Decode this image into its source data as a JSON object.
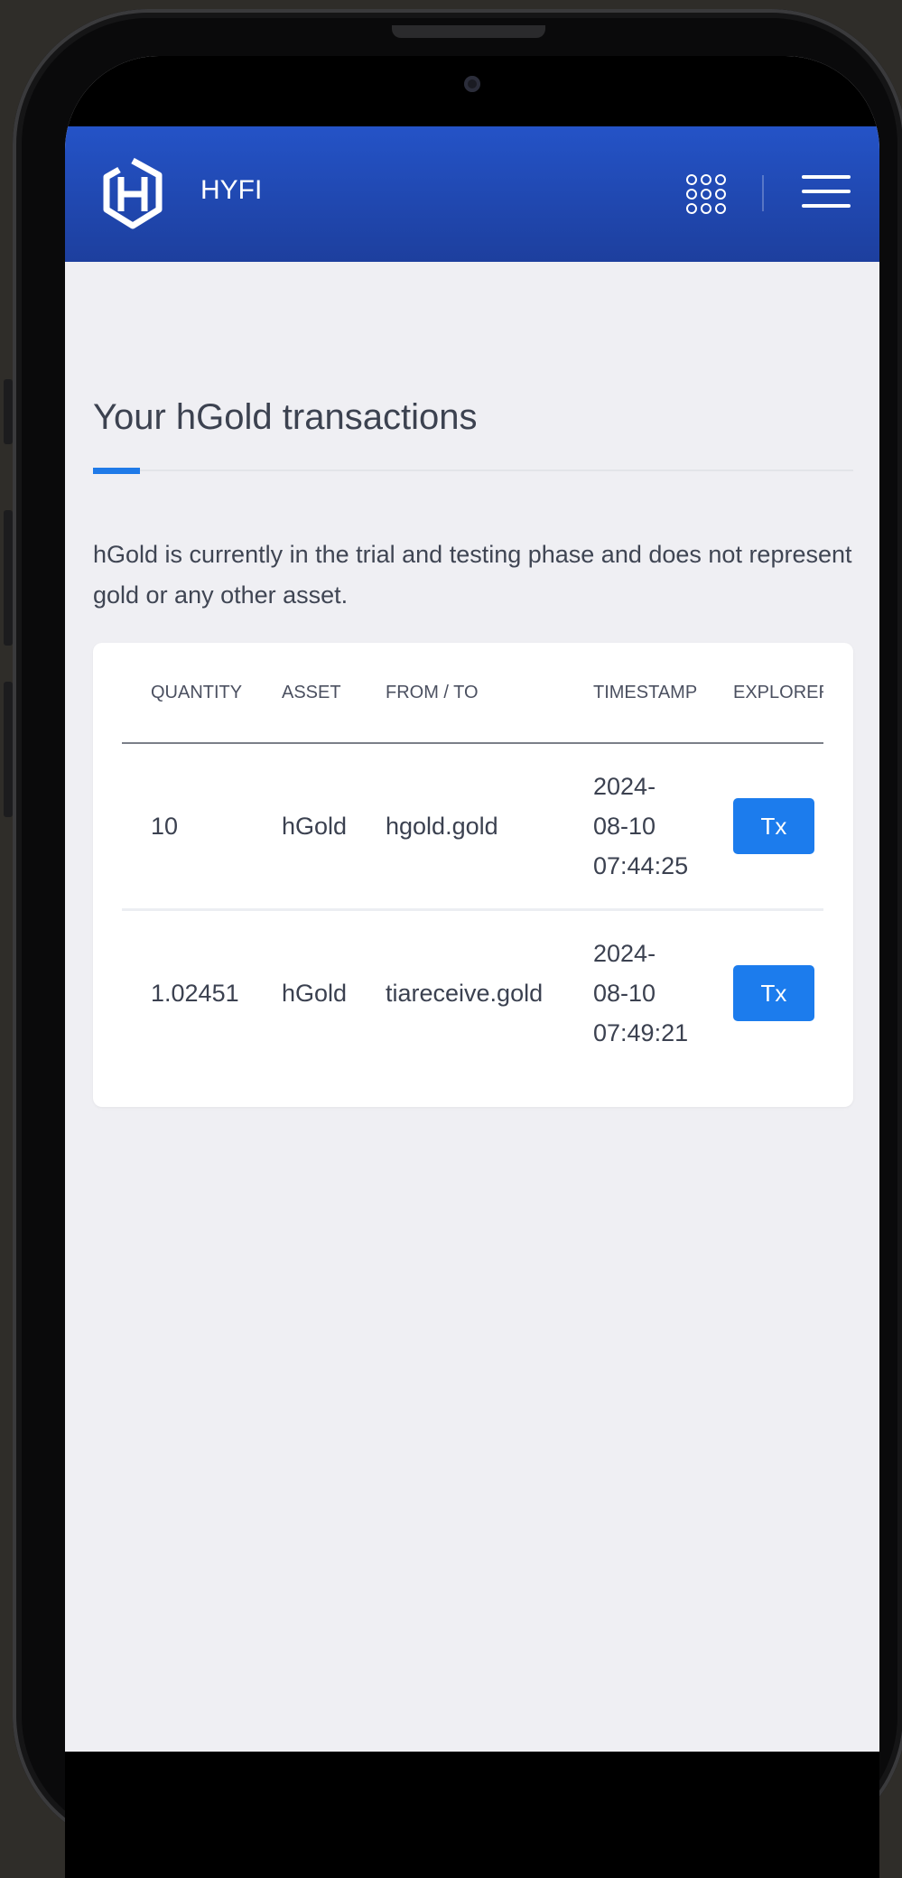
{
  "navbar": {
    "brand": "HYFI",
    "logo_icon": "hyfi-logo-icon",
    "apps_icon": "grid-dots-icon",
    "menu_icon": "hamburger-menu-icon",
    "color_top": "#2453c7",
    "color_bottom": "#1d3f9e"
  },
  "page": {
    "title": "Your hGold transactions",
    "description": "hGold is currently in the trial and testing phase and does not represent gold or any other asset.",
    "accent_color": "#1f7ae8"
  },
  "table": {
    "columns": [
      "QUANTITY",
      "ASSET",
      "FROM / TO",
      "TIMESTAMP",
      "EXPLORER"
    ],
    "rows": [
      {
        "quantity": "10",
        "asset": "hGold",
        "from_to": "hgold.gold",
        "timestamp_date": "2024-",
        "timestamp_date2": "08-10",
        "timestamp_time": "07:44:25",
        "explorer_label": "Tx"
      },
      {
        "quantity": "1.02451",
        "asset": "hGold",
        "from_to": "tiareceive.gold",
        "timestamp_date": "2024-",
        "timestamp_date2": "08-10",
        "timestamp_time": "07:49:21",
        "explorer_label": "Tx"
      }
    ],
    "button_color": "#1c7ced"
  }
}
